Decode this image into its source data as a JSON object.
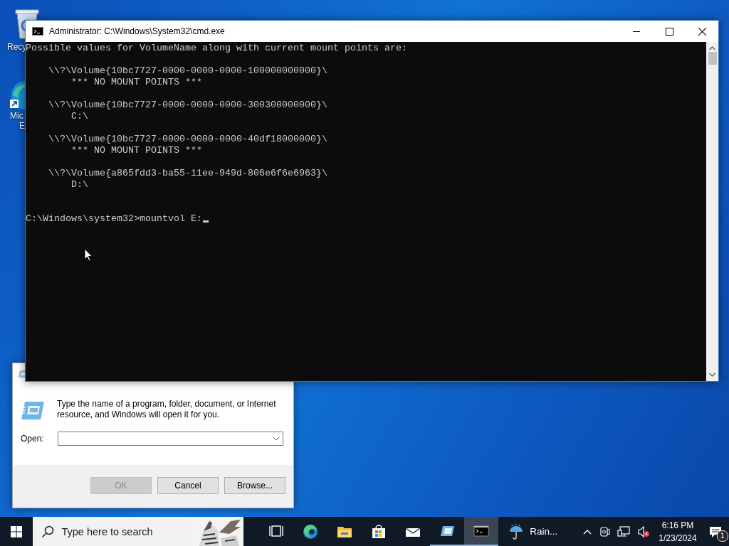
{
  "desktop_icons": [
    {
      "label": "Recy"
    },
    {
      "label": "Mic",
      "label_2": "E"
    }
  ],
  "console_window": {
    "title": "Administrator: C:\\Windows\\System32\\cmd.exe",
    "header": "Possible values for VolumeName along with current mount points are:",
    "volumes": [
      {
        "name": "\\\\?\\Volume{10bc7727-0000-0000-0000-100000000000}\\",
        "mount": "*** NO MOUNT POINTS ***"
      },
      {
        "name": "\\\\?\\Volume{10bc7727-0000-0000-0000-300300000000}\\",
        "mount": "C:\\"
      },
      {
        "name": "\\\\?\\Volume{10bc7727-0000-0000-0000-40df18000000}\\",
        "mount": "*** NO MOUNT POINTS ***"
      },
      {
        "name": "\\\\?\\Volume{a865fdd3-ba55-11ee-949d-806e6f6e6963}\\",
        "mount": "D:\\"
      }
    ],
    "prompt": "C:\\Windows\\system32>mountvol E:"
  },
  "run_dialog": {
    "description": "Type the name of a program, folder, document, or Internet resource, and Windows will open it for you.",
    "open_label": "Open:",
    "buttons": [
      {
        "label": "OK",
        "disabled": true
      },
      {
        "label": "Cancel",
        "disabled": false
      },
      {
        "label": "Browse...",
        "disabled": false
      }
    ]
  },
  "taskbar": {
    "search": {
      "placeholder": "Type here to search"
    },
    "apps": [
      {
        "kind": "taskview",
        "running": false,
        "selected": false
      },
      {
        "kind": "edge",
        "running": false,
        "selected": false
      },
      {
        "kind": "explorer",
        "running": false,
        "selected": false
      },
      {
        "kind": "store",
        "running": false,
        "selected": false
      },
      {
        "kind": "mail",
        "running": false,
        "selected": false
      },
      {
        "kind": "run",
        "running": true,
        "selected": false
      },
      {
        "kind": "console",
        "running": true,
        "selected": true
      }
    ],
    "weather": "Rain...",
    "time": "6:16 PM",
    "date": "1/23/2024",
    "notification_count": "1"
  }
}
